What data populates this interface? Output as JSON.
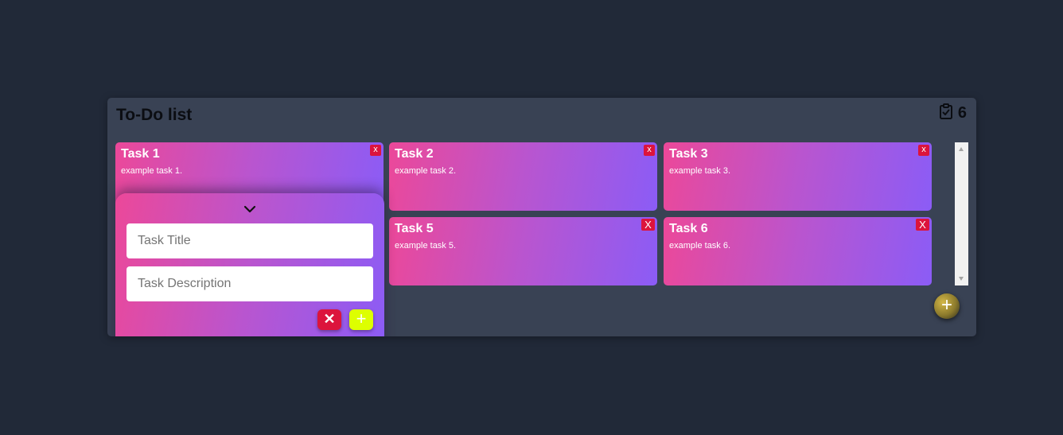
{
  "header": {
    "title": "To-Do list",
    "count": "6"
  },
  "icons": {
    "counter_icon": "clipboard-check-icon",
    "drawer_toggle": "chevron-down-icon",
    "fab": "plus-icon"
  },
  "tasks": [
    {
      "title": "Task 1",
      "description": "example task 1.",
      "delete_label": "x"
    },
    {
      "title": "Task 2",
      "description": "example task 2.",
      "delete_label": "x"
    },
    {
      "title": "Task 3",
      "description": "example task 3.",
      "delete_label": "x"
    },
    {
      "title": "Task 5",
      "description": "example task 5.",
      "delete_label": "X"
    },
    {
      "title": "Task 6",
      "description": "example task 6.",
      "delete_label": "X"
    }
  ],
  "form": {
    "title_placeholder": "Task Title",
    "title_value": "",
    "description_placeholder": "Task Description",
    "description_value": "",
    "cancel_label": "✕",
    "add_label": "+"
  },
  "fab_label": "+",
  "colors": {
    "page_bg": "#212938",
    "panel_bg": "#394254",
    "card_gradient_start": "#ec4899",
    "card_gradient_end": "#8b5cf6",
    "delete_red": "#dc143c",
    "add_yellow": "#ddff00"
  }
}
